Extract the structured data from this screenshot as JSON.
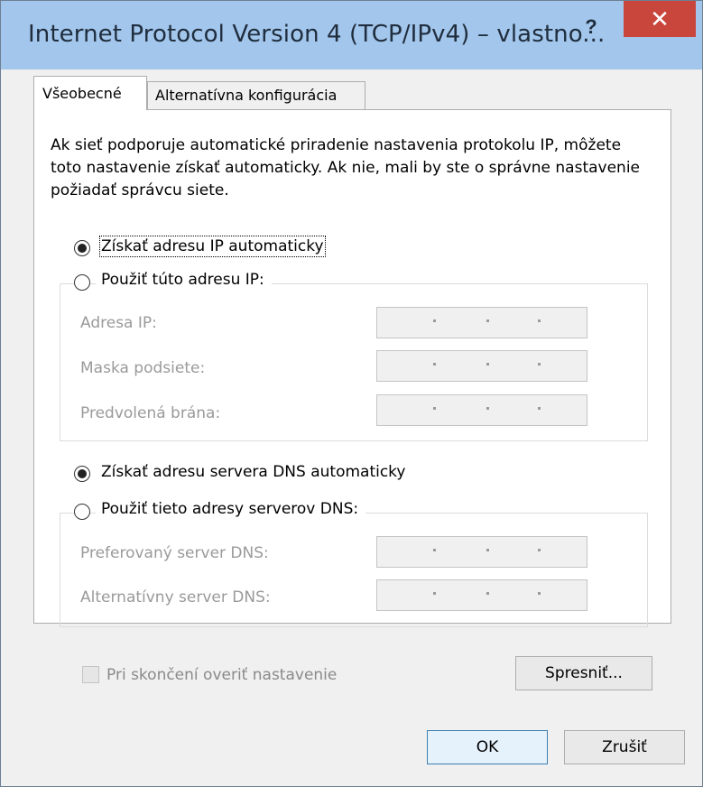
{
  "window": {
    "title": "Internet Protocol Version 4 (TCP/IPv4) – vlastno...",
    "help_label": "?",
    "close_label": "✕"
  },
  "tabs": [
    {
      "label": "Všeobecné",
      "active": true
    },
    {
      "label": "Alternatívna konfigurácia",
      "active": false
    }
  ],
  "description": "Ak sieť podporuje automatické priradenie nastavenia protokolu IP, môžete toto nastavenie získať automaticky. Ak nie, mali by ste o správne nastavenie požiadať správcu siete.",
  "ip_section": {
    "auto_label": "Získať adresu IP automaticky",
    "auto_selected": true,
    "manual_label": "Použiť túto adresu IP:",
    "fields": [
      {
        "label": "Adresa IP:",
        "value": ""
      },
      {
        "label": "Maska podsiete:",
        "value": ""
      },
      {
        "label": "Predvolená brána:",
        "value": ""
      }
    ]
  },
  "dns_section": {
    "auto_label": "Získať adresu servera DNS automaticky",
    "auto_selected": true,
    "manual_label": "Použiť tieto adresy serverov DNS:",
    "fields": [
      {
        "label": "Preferovaný server DNS:",
        "value": ""
      },
      {
        "label": "Alternatívny server DNS:",
        "value": ""
      }
    ]
  },
  "validate": {
    "label": "Pri skončení overiť nastavenie",
    "checked": false,
    "enabled": false
  },
  "buttons": {
    "advanced": "Spresniť...",
    "ok": "OK",
    "cancel": "Zrušiť"
  },
  "colors": {
    "titlebar": "#a3c6ec",
    "close": "#c9463d",
    "ok_border": "#3c7fb1"
  }
}
